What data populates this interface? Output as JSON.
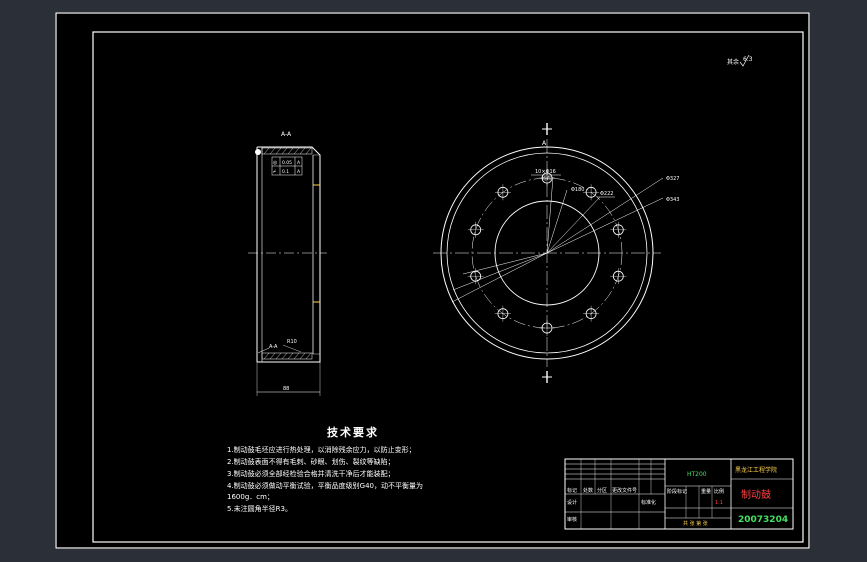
{
  "section_label": "A-A",
  "scale_note": "其余",
  "roughness_value": "6.3",
  "tolerance": {
    "row1_symbol": "◎",
    "row1_value": "0.05",
    "row1_datum": "A",
    "row2_symbol": "⌿",
    "row2_value": "0.1",
    "row2_datum": "A"
  },
  "dims": {
    "radius": "R10",
    "width": "88",
    "d1": "Φ327",
    "d2": "Φ343",
    "d3": "Φ222",
    "d4": "Φ180",
    "holes": "10×Φ16",
    "holes_note": "均布",
    "datum_a": "A"
  },
  "tech_title": "技术要求",
  "tech_items": [
    "1.制动鼓毛坯应进行热处理，以消除残余应力，以防止变形；",
    "2.制动鼓表面不得有毛刺、砂眼、划伤、裂纹等缺陷；",
    "3.制动鼓必须全部经检验合格并清洗干净后才能装配；",
    "4.制动鼓必须做动平衡试验，平衡品度级别G40，动不平衡量为",
    "1600g．cm；",
    "5.未注圆角半径R3。"
  ],
  "title_block": {
    "material": "HT200",
    "school": "黑龙江工程学院",
    "part_name": "制动鼓",
    "drawing_no": "20073204",
    "designer_label": "设计",
    "reviewer_label": "审核",
    "label_marks": "标记",
    "label_count": "处数",
    "label_zone": "分区",
    "label_change_no": "更改文件号",
    "label_sign": "签名",
    "label_date": "年月日",
    "label_std": "标准化",
    "label_stage": "阶段标记",
    "label_weight": "重量",
    "label_scale": "比例",
    "scale_value": "1:1",
    "label_sheets": "共 张 第 张"
  },
  "colors": {
    "line": "#ffffff",
    "accent_yellow": "#ffd34d",
    "accent_green": "#44e060",
    "accent_red": "#ff4040",
    "background": "#000000",
    "frame_outside": "#2b3038"
  }
}
